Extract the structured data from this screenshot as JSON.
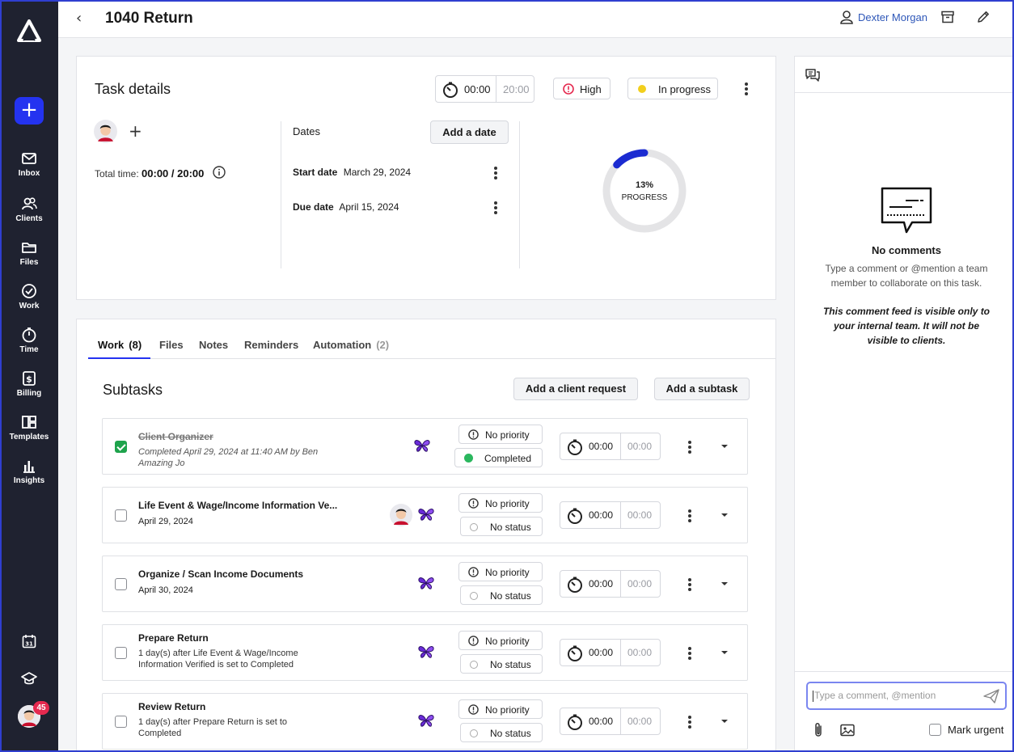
{
  "header": {
    "back_icon": "chevron-left-icon",
    "title": "1040 Return",
    "user_name": "Dexter Morgan"
  },
  "sidebar": {
    "nav": [
      {
        "label": "Inbox",
        "icon": "mail-icon"
      },
      {
        "label": "Clients",
        "icon": "users-icon"
      },
      {
        "label": "Files",
        "icon": "folder-icon"
      },
      {
        "label": "Work",
        "icon": "check-circle-icon"
      },
      {
        "label": "Time",
        "icon": "stopwatch-icon"
      },
      {
        "label": "Billing",
        "icon": "dollar-icon"
      },
      {
        "label": "Templates",
        "icon": "templates-icon"
      },
      {
        "label": "Insights",
        "icon": "bar-chart-icon"
      }
    ],
    "calendar_day": "31",
    "notification_count": "45"
  },
  "task_details": {
    "title": "Task details",
    "timer_elapsed": "00:00",
    "timer_budget": "20:00",
    "priority": "High",
    "status": "In progress",
    "total_time_label": "Total time:",
    "total_time_value": "00:00 / 20:00",
    "dates_label": "Dates",
    "add_date_button": "Add a date",
    "start_date_label": "Start date",
    "start_date": "March 29, 2024",
    "due_date_label": "Due date",
    "due_date": "April 15, 2024",
    "progress_percent_label": "13%",
    "progress_label": "PROGRESS",
    "progress_fraction": 0.13,
    "colors": {
      "progress": "#1b2bd1",
      "track": "#e4e4e6",
      "status_dot": "#f2cf1d",
      "priority_icon": "#e5294f"
    }
  },
  "work": {
    "tabs": [
      {
        "label": "Work",
        "count": "(8)"
      },
      {
        "label": "Files",
        "count": ""
      },
      {
        "label": "Notes",
        "count": ""
      },
      {
        "label": "Reminders",
        "count": ""
      },
      {
        "label": "Automation",
        "count": "(2)"
      }
    ],
    "subtasks_title": "Subtasks",
    "add_client_request_button": "Add a client request",
    "add_subtask_button": "Add a subtask",
    "rows": [
      {
        "title": "Client Organizer",
        "subtitle": "Completed April 29, 2024 at 11:40 AM by Ben Amazing Jo",
        "priority": "No priority",
        "status": "Completed",
        "elapsed": "00:00",
        "budget": "00:00",
        "checked": true
      },
      {
        "title": "Life Event & Wage/Income Information Ve...",
        "subtitle": "April 29, 2024",
        "priority": "No priority",
        "status": "No status",
        "elapsed": "00:00",
        "budget": "00:00",
        "checked": false
      },
      {
        "title": "Organize / Scan Income Documents",
        "subtitle": "April 30, 2024",
        "priority": "No priority",
        "status": "No status",
        "elapsed": "00:00",
        "budget": "00:00",
        "checked": false
      },
      {
        "title": "Prepare Return",
        "subtitle": "1 day(s) after Life Event & Wage/Income Information Verified is set to Completed",
        "priority": "No priority",
        "status": "No status",
        "elapsed": "00:00",
        "budget": "00:00",
        "checked": false
      },
      {
        "title": "Review Return",
        "subtitle": "1 day(s) after Prepare Return is set to Completed",
        "priority": "No priority",
        "status": "No status",
        "elapsed": "00:00",
        "budget": "00:00",
        "checked": false
      }
    ]
  },
  "comments": {
    "empty_title": "No comments",
    "empty_subtitle": "Type a comment or @mention a team member to collaborate on this task.",
    "visibility_note": "This comment feed is visible only to your internal team. It will not be visible to clients.",
    "input_placeholder": "Type a comment, @mention",
    "mark_urgent_label": "Mark urgent"
  }
}
